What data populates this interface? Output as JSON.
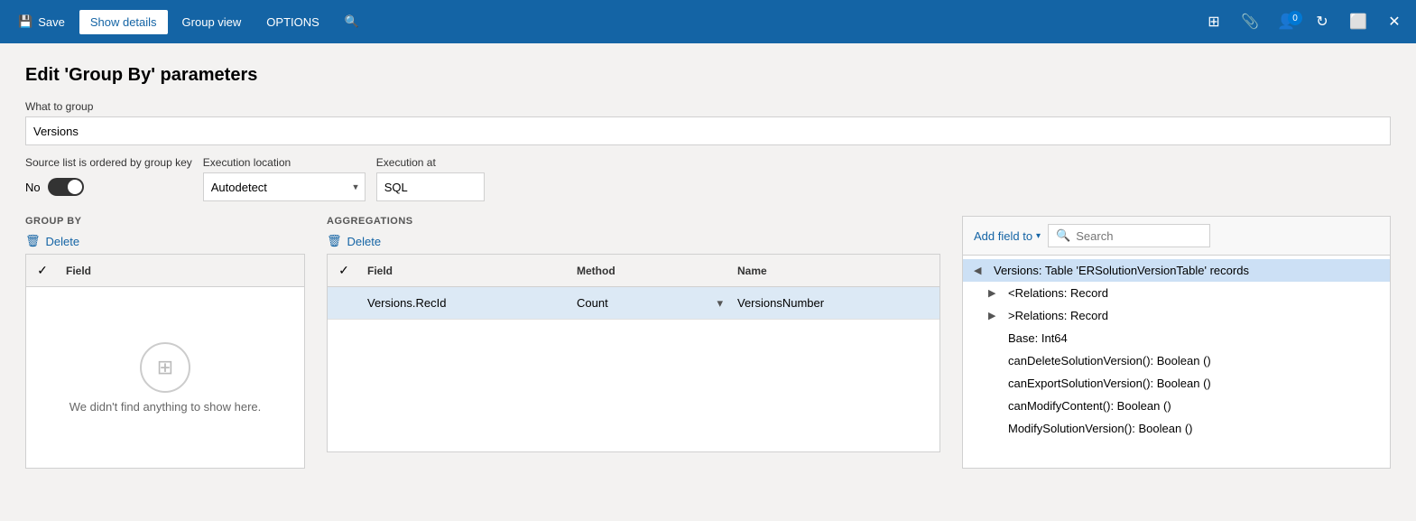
{
  "titlebar": {
    "save_label": "Save",
    "show_details_label": "Show details",
    "group_view_label": "Group view",
    "options_label": "OPTIONS",
    "badge_count": "0"
  },
  "page": {
    "title": "Edit 'Group By' parameters",
    "what_to_group_label": "What to group",
    "what_to_group_value": "Versions",
    "source_ordered_label": "Source list is ordered by group key",
    "toggle_label": "No",
    "execution_location_label": "Execution location",
    "execution_location_value": "Autodetect",
    "execution_at_label": "Execution at",
    "execution_at_value": "SQL"
  },
  "group_by": {
    "header": "GROUP BY",
    "delete_label": "Delete",
    "field_col": "Field",
    "empty_text": "We didn't find anything to show here."
  },
  "aggregations": {
    "header": "AGGREGATIONS",
    "delete_label": "Delete",
    "field_col": "Field",
    "method_col": "Method",
    "name_col": "Name",
    "rows": [
      {
        "field": "Versions.RecId",
        "method": "Count",
        "name": "VersionsNumber"
      }
    ]
  },
  "right_panel": {
    "add_field_label": "Add field to",
    "search_placeholder": "Search",
    "tree_items": [
      {
        "indent": 0,
        "expand": "collapse",
        "label": "Versions: Table 'ERSolutionVersionTable' records",
        "selected": true
      },
      {
        "indent": 1,
        "expand": "expand",
        "label": "<Relations: Record",
        "selected": false
      },
      {
        "indent": 1,
        "expand": "expand",
        "label": ">Relations: Record",
        "selected": false
      },
      {
        "indent": 1,
        "expand": "none",
        "label": "Base: Int64",
        "selected": false
      },
      {
        "indent": 1,
        "expand": "none",
        "label": "canDeleteSolutionVersion(): Boolean ()",
        "selected": false
      },
      {
        "indent": 1,
        "expand": "none",
        "label": "canExportSolutionVersion(): Boolean ()",
        "selected": false
      },
      {
        "indent": 1,
        "expand": "none",
        "label": "canModifyContent(): Boolean ()",
        "selected": false
      },
      {
        "indent": 1,
        "expand": "none",
        "label": "ModifySolutionVersion(): Boolean ()",
        "selected": false
      }
    ]
  }
}
